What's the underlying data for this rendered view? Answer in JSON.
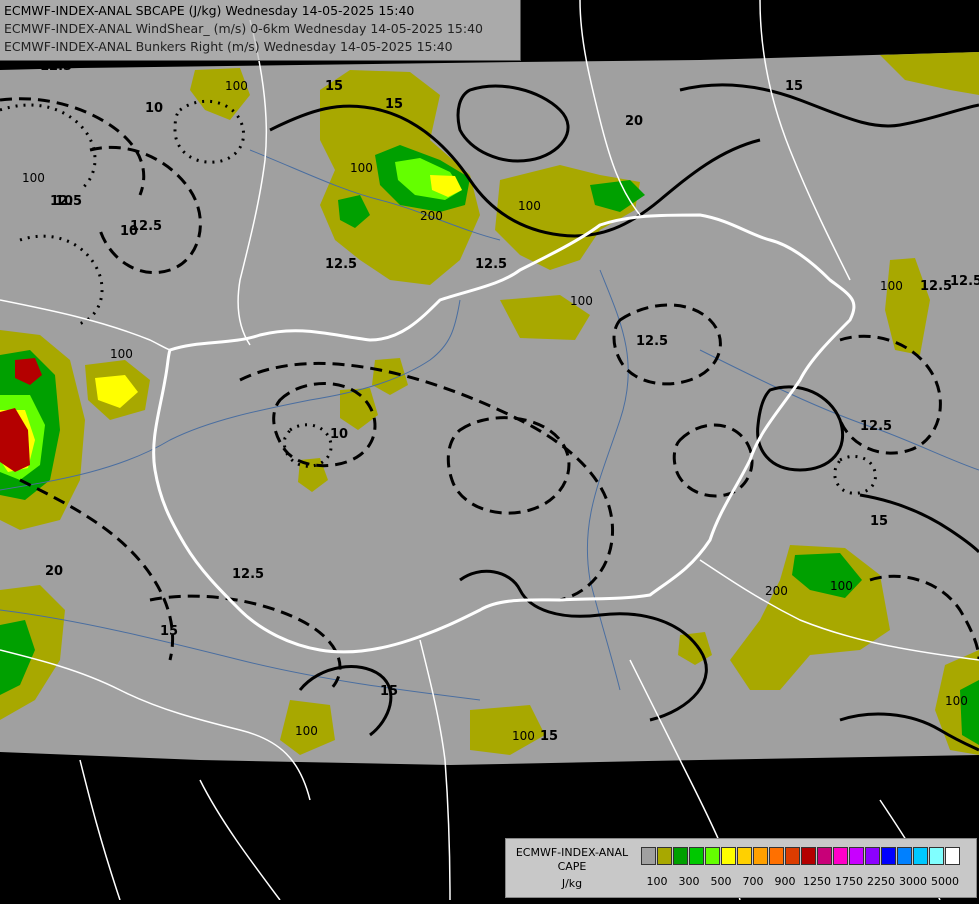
{
  "titles": {
    "line1": "ECMWF-INDEX-ANAL SBCAPE (J/kg) Wednesday 14-05-2025 15:40",
    "line2": "ECMWF-INDEX-ANAL WindShear_ (m/s) 0-6km Wednesday 14-05-2025 15:40",
    "line3": "ECMWF-INDEX-ANAL Bunkers Right (m/s) Wednesday 14-05-2025 15:40"
  },
  "legend": {
    "title_line1": "ECMWF-INDEX-ANAL",
    "title_line2": "CAPE",
    "title_line3": "J/kg",
    "colors": [
      "#a0a0a0",
      "#a8a800",
      "#00a000",
      "#00c800",
      "#64ff00",
      "#ffff00",
      "#ffd000",
      "#ffa000",
      "#ff7000",
      "#dc3c00",
      "#b40000",
      "#c80078",
      "#ff00c8",
      "#c800ff",
      "#8c00ff",
      "#0000ff",
      "#0080ff",
      "#00c8ff",
      "#80ffff",
      "#ffffff"
    ],
    "ticks": [
      "100",
      "300",
      "500",
      "700",
      "900",
      "1250",
      "1750",
      "2250",
      "3000",
      "5000"
    ]
  },
  "map": {
    "domain_fill": "#a0a0a0",
    "outside_fill": "#000000",
    "border_color": "#ffffff",
    "river_color": "#4a6ea0",
    "contour_color": "#000000",
    "contour_labels": [
      "12.5",
      "15",
      "10",
      "20",
      "12.5",
      "15",
      "12.5",
      "12.5",
      "12.5",
      "15",
      "12.5",
      "12.5",
      "15",
      "12.5",
      "15",
      "10",
      "10",
      "10",
      "12.5",
      "15",
      "12.5",
      "20",
      "15"
    ],
    "cape_labels": [
      "100",
      "100",
      "100",
      "200",
      "100",
      "100",
      "100",
      "100",
      "100",
      "200",
      "100",
      "100",
      "100"
    ]
  }
}
